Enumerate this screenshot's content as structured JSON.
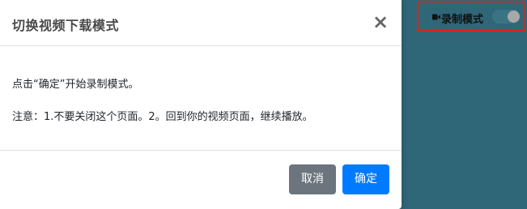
{
  "modal": {
    "title": "切换视频下载模式",
    "close_symbol": "×",
    "body_line1": "点击“确定”开始录制模式。",
    "body_line2": "注意：1.不要关闭这个页面。2。回到你的视频页面，继续播放。",
    "cancel_label": "取消",
    "ok_label": "确定"
  },
  "record_toggle": {
    "label": "录制模式",
    "icon": "video-camera-icon",
    "state": "off"
  },
  "colors": {
    "background": "#2f6778",
    "ok_button": "#007bff",
    "cancel_button": "#6c757d",
    "highlight_border": "#e02020"
  }
}
